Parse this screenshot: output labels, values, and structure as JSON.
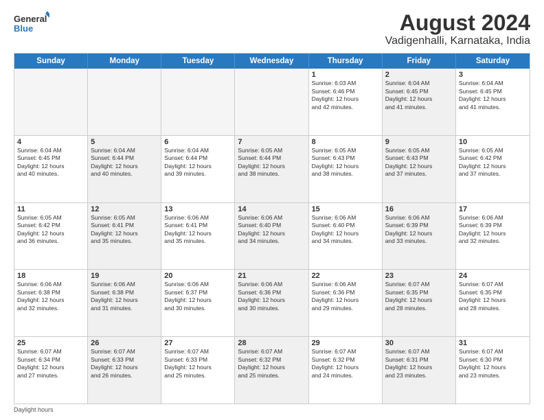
{
  "header": {
    "logo_line1": "General",
    "logo_line2": "Blue",
    "title": "August 2024",
    "subtitle": "Vadigenhalli, Karnataka, India"
  },
  "weekdays": [
    "Sunday",
    "Monday",
    "Tuesday",
    "Wednesday",
    "Thursday",
    "Friday",
    "Saturday"
  ],
  "weeks": [
    [
      {
        "day": "",
        "info": "",
        "shaded": true,
        "empty": true
      },
      {
        "day": "",
        "info": "",
        "shaded": true,
        "empty": true
      },
      {
        "day": "",
        "info": "",
        "shaded": true,
        "empty": true
      },
      {
        "day": "",
        "info": "",
        "shaded": true,
        "empty": true
      },
      {
        "day": "1",
        "info": "Sunrise: 6:03 AM\nSunset: 6:46 PM\nDaylight: 12 hours\nand 42 minutes.",
        "shaded": false
      },
      {
        "day": "2",
        "info": "Sunrise: 6:04 AM\nSunset: 6:45 PM\nDaylight: 12 hours\nand 41 minutes.",
        "shaded": true
      },
      {
        "day": "3",
        "info": "Sunrise: 6:04 AM\nSunset: 6:45 PM\nDaylight: 12 hours\nand 41 minutes.",
        "shaded": false
      }
    ],
    [
      {
        "day": "4",
        "info": "Sunrise: 6:04 AM\nSunset: 6:45 PM\nDaylight: 12 hours\nand 40 minutes.",
        "shaded": false
      },
      {
        "day": "5",
        "info": "Sunrise: 6:04 AM\nSunset: 6:44 PM\nDaylight: 12 hours\nand 40 minutes.",
        "shaded": true
      },
      {
        "day": "6",
        "info": "Sunrise: 6:04 AM\nSunset: 6:44 PM\nDaylight: 12 hours\nand 39 minutes.",
        "shaded": false
      },
      {
        "day": "7",
        "info": "Sunrise: 6:05 AM\nSunset: 6:44 PM\nDaylight: 12 hours\nand 38 minutes.",
        "shaded": true
      },
      {
        "day": "8",
        "info": "Sunrise: 6:05 AM\nSunset: 6:43 PM\nDaylight: 12 hours\nand 38 minutes.",
        "shaded": false
      },
      {
        "day": "9",
        "info": "Sunrise: 6:05 AM\nSunset: 6:43 PM\nDaylight: 12 hours\nand 37 minutes.",
        "shaded": true
      },
      {
        "day": "10",
        "info": "Sunrise: 6:05 AM\nSunset: 6:42 PM\nDaylight: 12 hours\nand 37 minutes.",
        "shaded": false
      }
    ],
    [
      {
        "day": "11",
        "info": "Sunrise: 6:05 AM\nSunset: 6:42 PM\nDaylight: 12 hours\nand 36 minutes.",
        "shaded": false
      },
      {
        "day": "12",
        "info": "Sunrise: 6:05 AM\nSunset: 6:41 PM\nDaylight: 12 hours\nand 35 minutes.",
        "shaded": true
      },
      {
        "day": "13",
        "info": "Sunrise: 6:06 AM\nSunset: 6:41 PM\nDaylight: 12 hours\nand 35 minutes.",
        "shaded": false
      },
      {
        "day": "14",
        "info": "Sunrise: 6:06 AM\nSunset: 6:40 PM\nDaylight: 12 hours\nand 34 minutes.",
        "shaded": true
      },
      {
        "day": "15",
        "info": "Sunrise: 6:06 AM\nSunset: 6:40 PM\nDaylight: 12 hours\nand 34 minutes.",
        "shaded": false
      },
      {
        "day": "16",
        "info": "Sunrise: 6:06 AM\nSunset: 6:39 PM\nDaylight: 12 hours\nand 33 minutes.",
        "shaded": true
      },
      {
        "day": "17",
        "info": "Sunrise: 6:06 AM\nSunset: 6:39 PM\nDaylight: 12 hours\nand 32 minutes.",
        "shaded": false
      }
    ],
    [
      {
        "day": "18",
        "info": "Sunrise: 6:06 AM\nSunset: 6:38 PM\nDaylight: 12 hours\nand 32 minutes.",
        "shaded": false
      },
      {
        "day": "19",
        "info": "Sunrise: 6:06 AM\nSunset: 6:38 PM\nDaylight: 12 hours\nand 31 minutes.",
        "shaded": true
      },
      {
        "day": "20",
        "info": "Sunrise: 6:06 AM\nSunset: 6:37 PM\nDaylight: 12 hours\nand 30 minutes.",
        "shaded": false
      },
      {
        "day": "21",
        "info": "Sunrise: 6:06 AM\nSunset: 6:36 PM\nDaylight: 12 hours\nand 30 minutes.",
        "shaded": true
      },
      {
        "day": "22",
        "info": "Sunrise: 6:06 AM\nSunset: 6:36 PM\nDaylight: 12 hours\nand 29 minutes.",
        "shaded": false
      },
      {
        "day": "23",
        "info": "Sunrise: 6:07 AM\nSunset: 6:35 PM\nDaylight: 12 hours\nand 28 minutes.",
        "shaded": true
      },
      {
        "day": "24",
        "info": "Sunrise: 6:07 AM\nSunset: 6:35 PM\nDaylight: 12 hours\nand 28 minutes.",
        "shaded": false
      }
    ],
    [
      {
        "day": "25",
        "info": "Sunrise: 6:07 AM\nSunset: 6:34 PM\nDaylight: 12 hours\nand 27 minutes.",
        "shaded": false
      },
      {
        "day": "26",
        "info": "Sunrise: 6:07 AM\nSunset: 6:33 PM\nDaylight: 12 hours\nand 26 minutes.",
        "shaded": true
      },
      {
        "day": "27",
        "info": "Sunrise: 6:07 AM\nSunset: 6:33 PM\nDaylight: 12 hours\nand 25 minutes.",
        "shaded": false
      },
      {
        "day": "28",
        "info": "Sunrise: 6:07 AM\nSunset: 6:32 PM\nDaylight: 12 hours\nand 25 minutes.",
        "shaded": true
      },
      {
        "day": "29",
        "info": "Sunrise: 6:07 AM\nSunset: 6:32 PM\nDaylight: 12 hours\nand 24 minutes.",
        "shaded": false
      },
      {
        "day": "30",
        "info": "Sunrise: 6:07 AM\nSunset: 6:31 PM\nDaylight: 12 hours\nand 23 minutes.",
        "shaded": true
      },
      {
        "day": "31",
        "info": "Sunrise: 6:07 AM\nSunset: 6:30 PM\nDaylight: 12 hours\nand 23 minutes.",
        "shaded": false
      }
    ]
  ],
  "footer": "Daylight hours"
}
